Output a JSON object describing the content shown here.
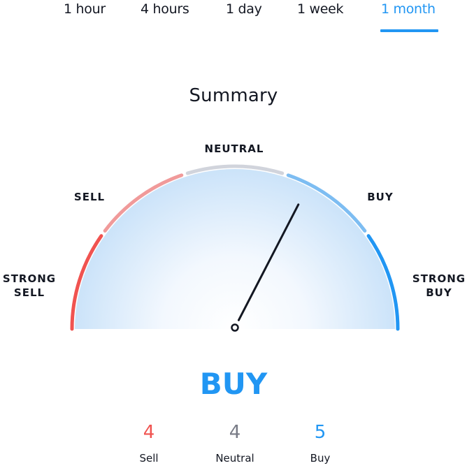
{
  "tabs": [
    {
      "label": "1 hour",
      "active": false
    },
    {
      "label": "4 hours",
      "active": false
    },
    {
      "label": "1 day",
      "active": false
    },
    {
      "label": "1 week",
      "active": false
    },
    {
      "label": "1 month",
      "active": true
    }
  ],
  "title": "Summary",
  "gauge": {
    "labels": {
      "strong_sell_line1": "STRONG",
      "strong_sell_line2": "SELL",
      "sell": "SELL",
      "neutral": "NEUTRAL",
      "buy": "BUY",
      "strong_buy_line1": "STRONG",
      "strong_buy_line2": "BUY"
    },
    "segment_colors": {
      "strong_sell": "#f05350",
      "sell": "#f09a9a",
      "neutral": "#d1d4dc",
      "buy": "#7dbdf2",
      "strong_buy": "#2196f3"
    },
    "needle_value": 0.3
  },
  "verdict": "BUY",
  "counts": {
    "sell": {
      "value": "4",
      "label": "Sell",
      "color": "#f05350"
    },
    "neutral": {
      "value": "4",
      "label": "Neutral",
      "color": "#787b86"
    },
    "buy": {
      "value": "5",
      "label": "Buy",
      "color": "#2196f3"
    }
  },
  "accent_color": "#2196f3"
}
